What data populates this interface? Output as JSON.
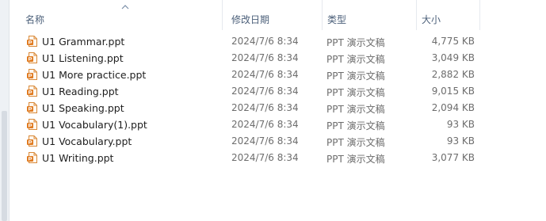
{
  "columns": {
    "name": "名称",
    "date": "修改日期",
    "type": "类型",
    "size": "大小"
  },
  "sort_icon": "sort-up-arrow-icon",
  "file_icon": "powerpoint-file-icon",
  "files": [
    {
      "name": "U1 Grammar.ppt",
      "date": "2024/7/6 8:34",
      "type": "PPT 演示文稿",
      "size": "4,775 KB"
    },
    {
      "name": "U1 Listening.ppt",
      "date": "2024/7/6 8:34",
      "type": "PPT 演示文稿",
      "size": "3,049 KB"
    },
    {
      "name": "U1 More practice.ppt",
      "date": "2024/7/6 8:34",
      "type": "PPT 演示文稿",
      "size": "2,882 KB"
    },
    {
      "name": "U1 Reading.ppt",
      "date": "2024/7/6 8:34",
      "type": "PPT 演示文稿",
      "size": "9,015 KB"
    },
    {
      "name": "U1 Speaking.ppt",
      "date": "2024/7/6 8:34",
      "type": "PPT 演示文稿",
      "size": "2,094 KB"
    },
    {
      "name": "U1 Vocabulary(1).ppt",
      "date": "2024/7/6 8:34",
      "type": "PPT 演示文稿",
      "size": "93 KB"
    },
    {
      "name": "U1 Vocabulary.ppt",
      "date": "2024/7/6 8:34",
      "type": "PPT 演示文稿",
      "size": "93 KB"
    },
    {
      "name": "U1 Writing.ppt",
      "date": "2024/7/6 8:34",
      "type": "PPT 演示文稿",
      "size": "3,077 KB"
    }
  ],
  "colors": {
    "header_text": "#4c607a",
    "icon_orange": "#e07a1f",
    "secondary_text": "#6d6d6d"
  }
}
